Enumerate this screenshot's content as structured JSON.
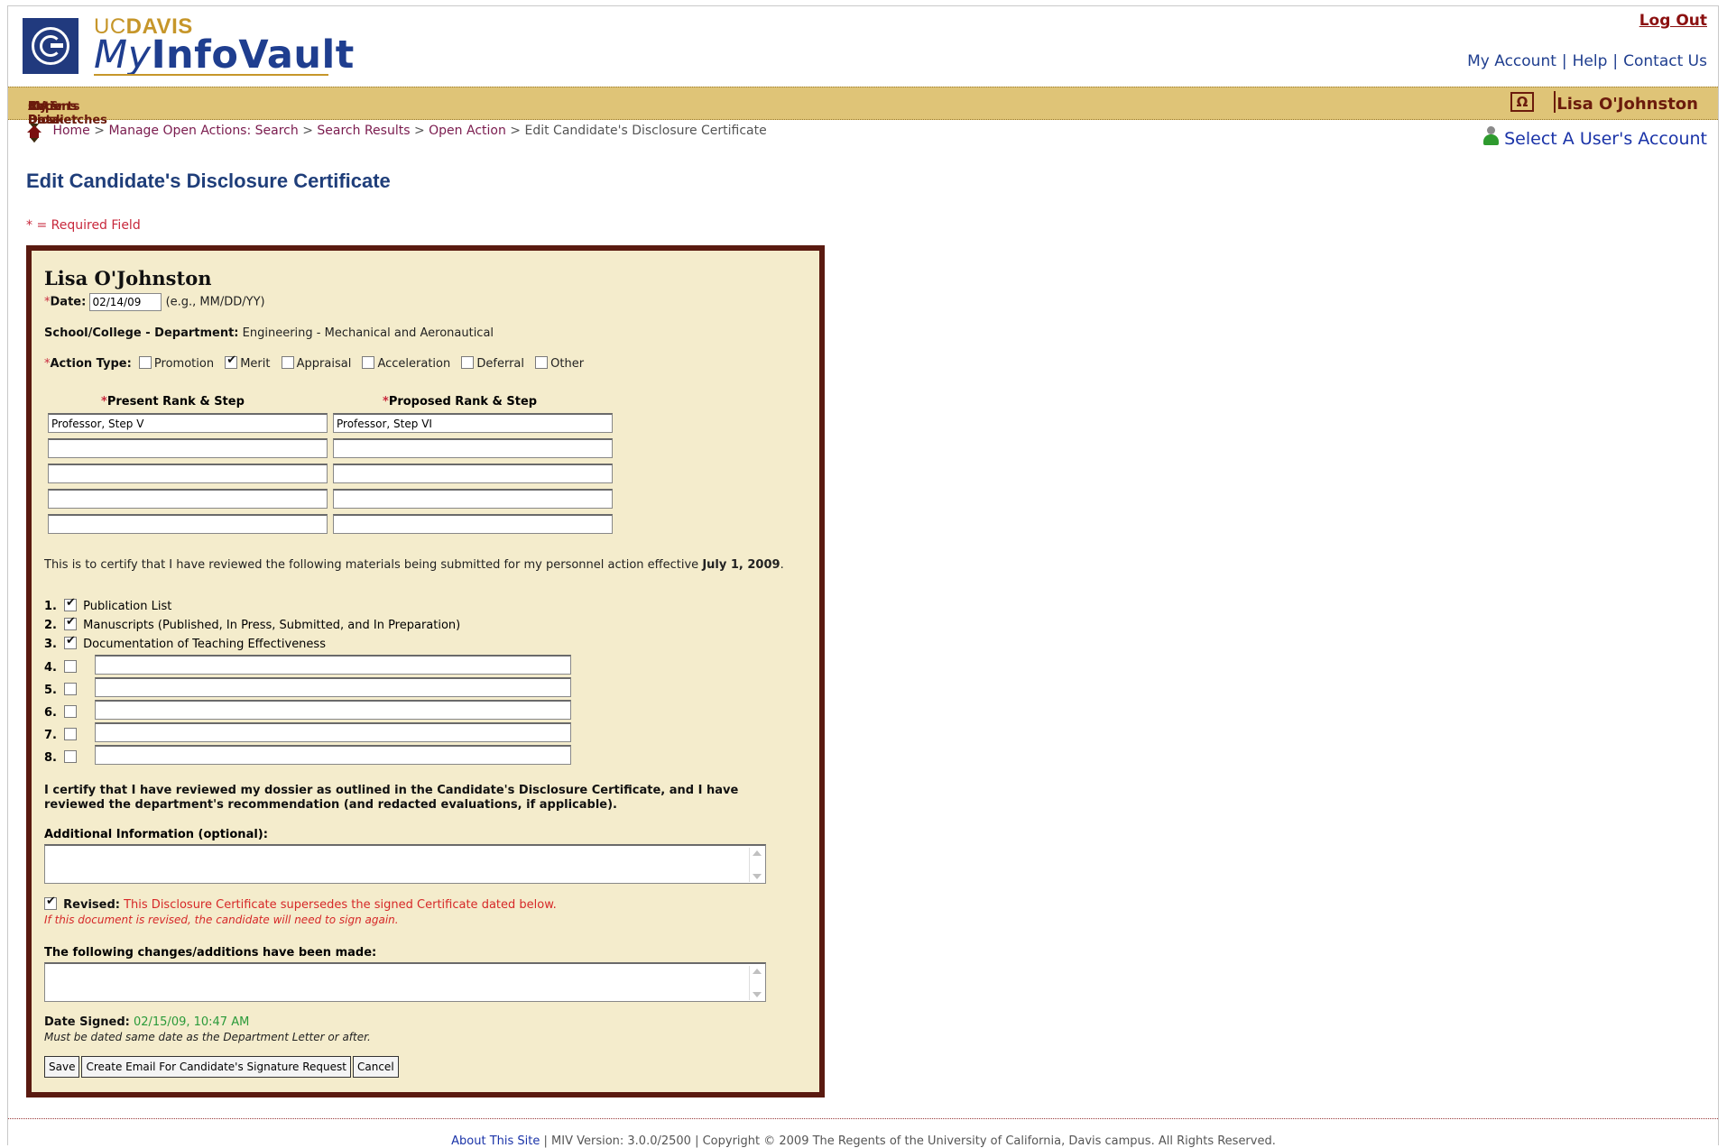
{
  "header": {
    "brand_uc": "UC",
    "brand_davis": "DAVIS",
    "brand_my": "My",
    "brand_infovault": "InfoVault",
    "logout": "Log Out",
    "my_account": "My Account",
    "help": "Help",
    "contact_us": "Contact Us",
    "sep": "|"
  },
  "nav": {
    "items": [
      "Enter Data",
      "My Dossier",
      "CV & Biosketches",
      "Actions",
      "Reports"
    ],
    "omega": "Ω",
    "user": "Lisa O'Johnston"
  },
  "breadcrumb": {
    "home": "Home",
    "manage": "Manage Open Actions: Search",
    "results": "Search Results",
    "open_action": "Open Action",
    "current": "Edit Candidate's Disclosure Certificate",
    "sep": ">"
  },
  "select_user": "Select A User's Account",
  "page": {
    "title": "Edit Candidate's Disclosure Certificate",
    "required_note": "* = Required Field"
  },
  "form": {
    "candidate_name": "Lisa O'Johnston",
    "required_mark": "*",
    "date_label": "Date:",
    "date_value": "02/14/09",
    "date_hint": "(e.g., MM/DD/YY)",
    "school_label": "School/College - Department:",
    "school_value": "Engineering - Mechanical and Aeronautical",
    "action_type_label": "Action Type:",
    "action_types": [
      {
        "label": "Promotion",
        "checked": false
      },
      {
        "label": "Merit",
        "checked": true
      },
      {
        "label": "Appraisal",
        "checked": false
      },
      {
        "label": "Acceleration",
        "checked": false
      },
      {
        "label": "Deferral",
        "checked": false
      },
      {
        "label": "Other",
        "checked": false
      }
    ],
    "present_rank_label": "Present Rank & Step",
    "proposed_rank_label": "Proposed Rank & Step",
    "present_ranks": [
      "Professor, Step V",
      "",
      "",
      "",
      ""
    ],
    "proposed_ranks": [
      "Professor, Step VI",
      "",
      "",
      "",
      ""
    ],
    "certify_text": "This is to certify that I have reviewed the following materials being submitted for my personnel action effective",
    "effective_date": "July 1, 2009",
    "period": ".",
    "materials": [
      {
        "num": "1.",
        "label": "Publication List",
        "checked": true
      },
      {
        "num": "2.",
        "label": "Manuscripts (Published, In Press, Submitted, and In Preparation)",
        "checked": true
      },
      {
        "num": "3.",
        "label": "Documentation of Teaching Effectiveness",
        "checked": true
      },
      {
        "num": "4.",
        "label": "",
        "checked": false
      },
      {
        "num": "5.",
        "label": "",
        "checked": false
      },
      {
        "num": "6.",
        "label": "",
        "checked": false
      },
      {
        "num": "7.",
        "label": "",
        "checked": false
      },
      {
        "num": "8.",
        "label": "",
        "checked": false
      }
    ],
    "certify_reviewed": "I certify that I have reviewed my dossier as outlined in the Candidate's Disclosure Certificate, and I have reviewed the department's recommendation (and redacted evaluations, if applicable).",
    "additional_info_label": "Additional Information (optional):",
    "additional_info_value": "",
    "revised_label": "Revised:",
    "revised_checked": true,
    "revised_text": "This Disclosure Certificate supersedes the signed Certificate dated below.",
    "revised_note": "If this document is revised, the candidate will need to sign again.",
    "changes_label": "The following changes/additions have been made:",
    "changes_value": "",
    "date_signed_label": "Date Signed:",
    "date_signed_value": "02/15/09, 10:47 AM",
    "date_signed_note": "Must be dated same date as the Department Letter or after.",
    "save_button": "Save",
    "email_button": "Create Email For Candidate's Signature Request",
    "cancel_button": "Cancel"
  },
  "footer": {
    "about": "About This Site",
    "text": "| MIV Version: 3.0.0/2500 | Copyright © 2009 The Regents of the University of California, Davis campus. All Rights Reserved."
  }
}
